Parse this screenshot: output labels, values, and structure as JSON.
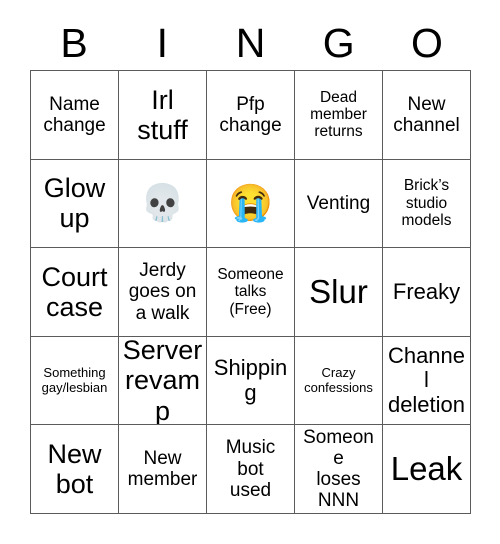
{
  "card": {
    "title": "BINGO Card",
    "header_letters": [
      "B",
      "I",
      "N",
      "G",
      "O"
    ],
    "rows": [
      [
        {
          "text": "Name\nchange",
          "size": "md",
          "type": "text"
        },
        {
          "text": "Irl\nstuff",
          "size": "xl",
          "type": "text"
        },
        {
          "text": "Pfp\nchange",
          "size": "md",
          "type": "text"
        },
        {
          "text": "Dead\nmember\nreturns",
          "size": "sm",
          "type": "text"
        },
        {
          "text": "New\nchannel",
          "size": "md",
          "type": "text"
        }
      ],
      [
        {
          "text": "Glow\nup",
          "size": "xl",
          "type": "text"
        },
        {
          "text": "💀",
          "size": "md",
          "type": "emoji",
          "icon": "skull-emoji"
        },
        {
          "text": "😭",
          "size": "md",
          "type": "emoji",
          "icon": "loudly-crying-face-emoji"
        },
        {
          "text": "Venting",
          "size": "md",
          "type": "text"
        },
        {
          "text": "Brick’s\nstudio\nmodels",
          "size": "sm",
          "type": "text"
        }
      ],
      [
        {
          "text": "Court\ncase",
          "size": "xl",
          "type": "text"
        },
        {
          "text": "Jerdy\ngoes on\na walk",
          "size": "md",
          "type": "text"
        },
        {
          "text": "Someone\ntalks\n(Free)",
          "size": "sm",
          "type": "text",
          "free": true
        },
        {
          "text": "Slur",
          "size": "xxl",
          "type": "text"
        },
        {
          "text": "Freaky",
          "size": "lg",
          "type": "text"
        }
      ],
      [
        {
          "text": "Something\ngay/lesbian",
          "size": "xs",
          "type": "text"
        },
        {
          "text": "Server\nrevamp",
          "size": "xl",
          "type": "text"
        },
        {
          "text": "Shipping",
          "size": "lg",
          "type": "text"
        },
        {
          "text": "Crazy\nconfessions",
          "size": "xs",
          "type": "text"
        },
        {
          "text": "Channel\ndeletion",
          "size": "lg",
          "type": "text"
        }
      ],
      [
        {
          "text": "New\nbot",
          "size": "xl",
          "type": "text"
        },
        {
          "text": "New\nmember",
          "size": "md",
          "type": "text"
        },
        {
          "text": "Music\nbot\nused",
          "size": "md",
          "type": "text"
        },
        {
          "text": "Someone\nloses\nNNN",
          "size": "md",
          "type": "text"
        },
        {
          "text": "Leak",
          "size": "xxl",
          "type": "text"
        }
      ]
    ],
    "colors": {
      "background": "#ffffff",
      "border": "#5b5b5b",
      "text": "#000000"
    }
  }
}
